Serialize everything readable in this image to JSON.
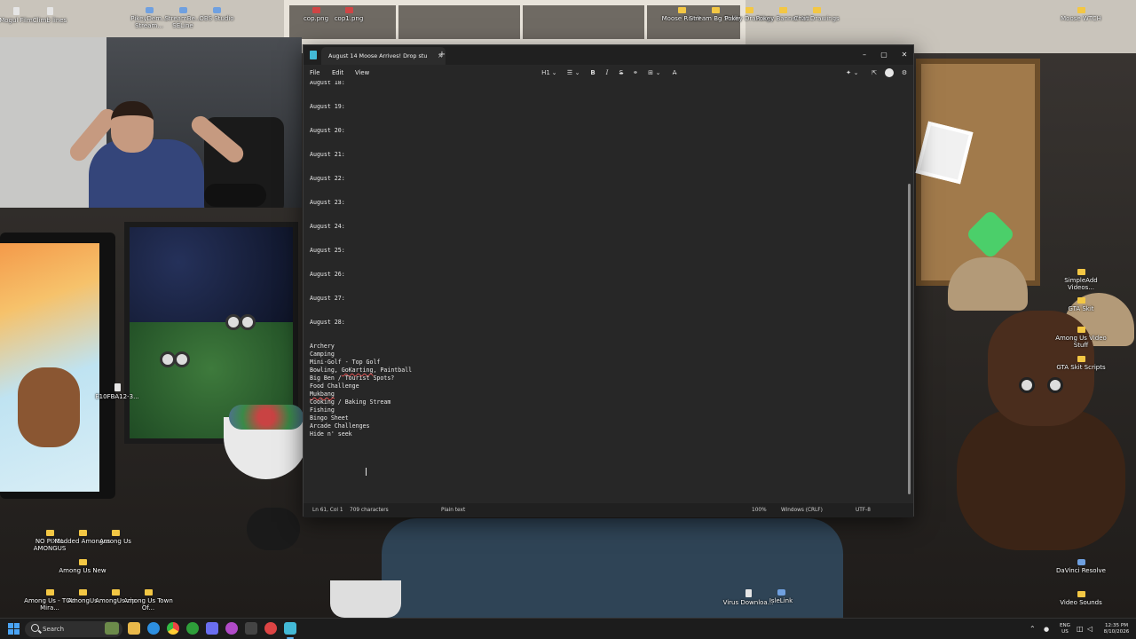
{
  "desktop": {
    "icons": [
      {
        "label": "Mogul Film"
      },
      {
        "label": "Climb lines"
      },
      {
        "label": "PikeyDem... Stream..."
      },
      {
        "label": "StreamBe... SELine"
      },
      {
        "label": "OBS Studio"
      },
      {
        "label": "cop.png"
      },
      {
        "label": "cop1.png"
      },
      {
        "label": "Moose Rivalt"
      },
      {
        "label": "Stream Bg Stelle"
      },
      {
        "label": "Pokey Drawings"
      },
      {
        "label": "Pokey Banner Art"
      },
      {
        "label": "Chat Drawings"
      },
      {
        "label": "Moose WTCH"
      },
      {
        "label": "E10FBA12-3..."
      },
      {
        "label": "SimpleAdd Videos..."
      },
      {
        "label": "GTA Skit"
      },
      {
        "label": "Among Us Video Stuff"
      },
      {
        "label": "GTA Skit Scripts"
      },
      {
        "label": "NO PIXEL AMONGUS"
      },
      {
        "label": "Modded Amongus"
      },
      {
        "label": "Among Us"
      },
      {
        "label": "Among Us New"
      },
      {
        "label": "Among Us - TOU Mira..."
      },
      {
        "label": "AmongUs"
      },
      {
        "label": "AmongUs.zip"
      },
      {
        "label": "Among Us Town Of..."
      },
      {
        "label": "Virus Downloa..."
      },
      {
        "label": "IsleLink"
      },
      {
        "label": "DaVinci Resolve"
      },
      {
        "label": "Video Sounds"
      }
    ]
  },
  "notepad": {
    "tab_title": "August 14 Moose Arrives! Drop stu",
    "tab_close": "×",
    "new_tab": "+",
    "window_buttons": {
      "minimize": "–",
      "maximize": "▢",
      "close": "✕"
    },
    "menu": {
      "file": "File",
      "edit": "Edit",
      "view": "View"
    },
    "toolbar": {
      "heading": "H1",
      "heading_chevron": "⌄",
      "list": "☰",
      "list_chevron": "⌄",
      "bold": "B",
      "italic": "I",
      "strikethrough": "S",
      "link": "⚭",
      "table": "⊞",
      "table_chevron": "⌄",
      "clear_format": "A̶",
      "copilot": "✦",
      "copilot_chevron": "⌄",
      "share": "⇱",
      "settings": "⚙"
    },
    "content_lines": [
      "August 18:",
      "",
      "",
      "August 19:",
      "",
      "",
      "August 20:",
      "",
      "",
      "August 21:",
      "",
      "",
      "August 22:",
      "",
      "",
      "August 23:",
      "",
      "",
      "August 24:",
      "",
      "",
      "August 25:",
      "",
      "",
      "August 26:",
      "",
      "",
      "August 27:",
      "",
      "",
      "August 28:",
      "",
      "",
      "Archery",
      "Camping",
      "Mini-Golf - Top Golf",
      "Bowling, GoKarting, Paintball",
      "Big Ben / Tourist Spots?",
      "Food Challenge",
      "Mukbang",
      "Cooking / Baking Stream",
      "Fishing",
      "Bingo Sheet",
      "Arcade Challenges",
      "Hide n' seek"
    ],
    "status": {
      "position": "Ln 61, Col 1",
      "characters": "709 characters",
      "format": "Plain text",
      "zoom": "100%",
      "line_ending": "Windows (CRLF)",
      "encoding": "UTF-8"
    }
  },
  "taskbar": {
    "search_placeholder": "Search",
    "apps": [
      "file-explorer",
      "edge",
      "chrome",
      "xbox",
      "discord",
      "snipping-tool",
      "obs",
      "notepad"
    ],
    "tray": {
      "chevron": "⌃",
      "language_top": "ENG",
      "language_bottom": "US",
      "time": "12:35 PM",
      "date": "8/10/2026"
    }
  },
  "colors": {
    "window_bg": "#272727",
    "titlebar_bg": "#202020",
    "text": "#e8e8e8",
    "spell_underline": "#e05252",
    "accent": "#60b4f0"
  }
}
